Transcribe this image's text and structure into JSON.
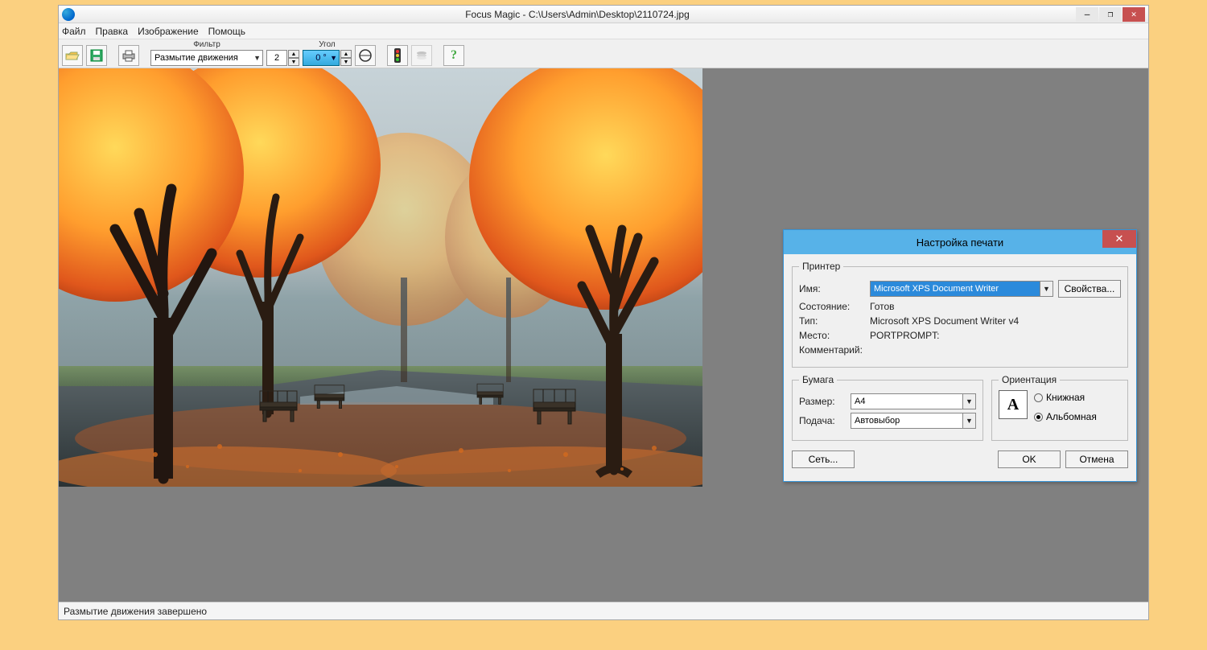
{
  "window": {
    "title": "Focus Magic - C:\\Users\\Admin\\Desktop\\2110724.jpg",
    "min": "—",
    "max": "❐",
    "close": "✕"
  },
  "menu": {
    "file": "Файл",
    "edit": "Правка",
    "image": "Изображение",
    "help": "Помощь"
  },
  "toolbar": {
    "filter_label": "Фильтр",
    "filter_value": "Размытие движения",
    "width_value": "2",
    "angle_label": "Угол",
    "angle_value": "0 °"
  },
  "status": "Размытие движения завершено",
  "dialog": {
    "title": "Настройка печати",
    "close": "✕",
    "printer_legend": "Принтер",
    "name_label": "Имя:",
    "name_value": "Microsoft XPS Document Writer",
    "properties": "Свойства...",
    "status_label": "Состояние:",
    "status_value": "Готов",
    "type_label": "Тип:",
    "type_value": "Microsoft XPS Document Writer v4",
    "place_label": "Место:",
    "place_value": "PORTPROMPT:",
    "comment_label": "Комментарий:",
    "comment_value": "",
    "paper_legend": "Бумага",
    "size_label": "Размер:",
    "size_value": "A4",
    "source_label": "Подача:",
    "source_value": "Автовыбор",
    "orient_legend": "Ориентация",
    "portrait": "Книжная",
    "landscape": "Альбомная",
    "page_glyph": "A",
    "network": "Сеть...",
    "ok": "OK",
    "cancel": "Отмена"
  }
}
